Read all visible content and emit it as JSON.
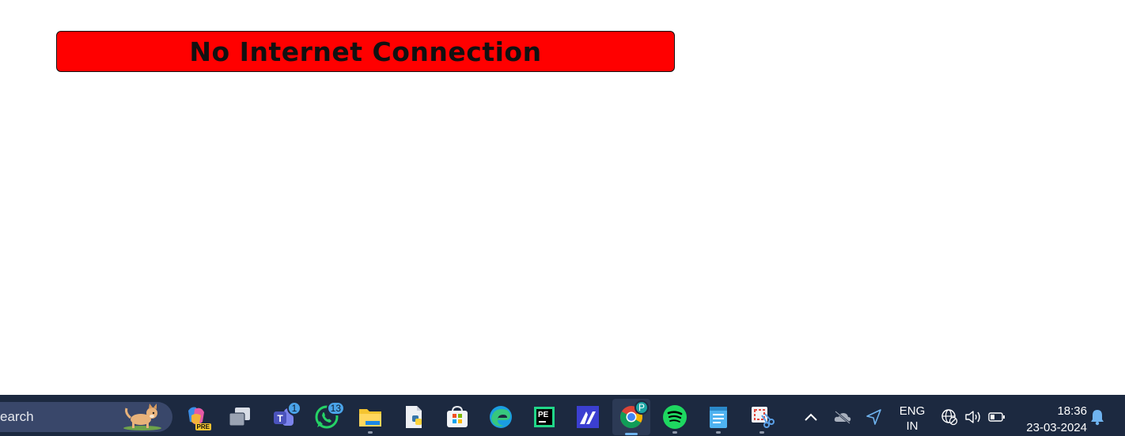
{
  "banner": {
    "text": "No Internet Connection"
  },
  "taskbar": {
    "search_text": "earch",
    "apps": [
      {
        "name": "copilot-icon",
        "badge": ""
      },
      {
        "name": "task-view-icon",
        "badge": ""
      },
      {
        "name": "teams-icon",
        "badge": "1"
      },
      {
        "name": "whatsapp-icon",
        "badge": "13"
      },
      {
        "name": "file-explorer-icon",
        "badge": ""
      },
      {
        "name": "python-file-icon",
        "badge": ""
      },
      {
        "name": "microsoft-store-icon",
        "badge": ""
      },
      {
        "name": "edge-icon",
        "badge": ""
      },
      {
        "name": "pycharm-icon",
        "badge": ""
      },
      {
        "name": "maple-icon",
        "badge": ""
      },
      {
        "name": "chrome-icon",
        "badge": "P"
      },
      {
        "name": "spotify-icon",
        "badge": ""
      },
      {
        "name": "notepad-icon",
        "badge": ""
      },
      {
        "name": "snipping-tool-icon",
        "badge": ""
      }
    ],
    "copilot_tag": "PRE",
    "pycharm_label": "PE"
  },
  "tray": {
    "language": "ENG",
    "region": "IN",
    "time": "18:36",
    "date": "23-03-2024"
  },
  "colors": {
    "banner_bg": "#ff0000",
    "taskbar_bg": "#1c2940",
    "search_bg": "#39476a",
    "badge": "#4aa3e8"
  }
}
